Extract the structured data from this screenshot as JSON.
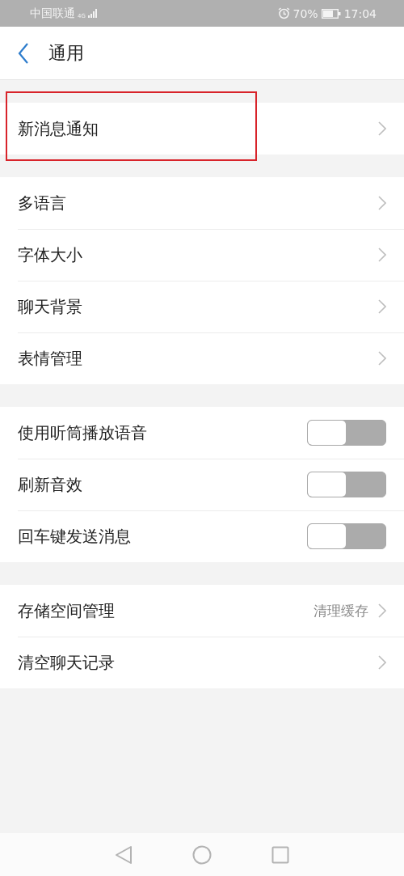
{
  "status_bar": {
    "carrier": "中国联通",
    "network": "4G",
    "battery": "70%",
    "time": "17:04"
  },
  "header": {
    "title": "通用"
  },
  "groups": [
    {
      "items": [
        {
          "kind": "link",
          "label": "新消息通知",
          "highlighted": true
        }
      ]
    },
    {
      "items": [
        {
          "kind": "link",
          "label": "多语言",
          "highlighted": false
        },
        {
          "kind": "link",
          "label": "字体大小",
          "highlighted": false
        },
        {
          "kind": "link",
          "label": "聊天背景",
          "highlighted": false
        },
        {
          "kind": "link",
          "label": "表情管理",
          "highlighted": false
        }
      ]
    },
    {
      "items": [
        {
          "kind": "toggle",
          "label": "使用听筒播放语音",
          "on": false
        },
        {
          "kind": "toggle",
          "label": "刷新音效",
          "on": false
        },
        {
          "kind": "toggle",
          "label": "回车键发送消息",
          "on": false
        }
      ]
    },
    {
      "items": [
        {
          "kind": "link",
          "label": "存储空间管理",
          "value": "清理缓存",
          "highlighted": false
        },
        {
          "kind": "link",
          "label": "清空聊天记录",
          "highlighted": false
        }
      ]
    }
  ]
}
